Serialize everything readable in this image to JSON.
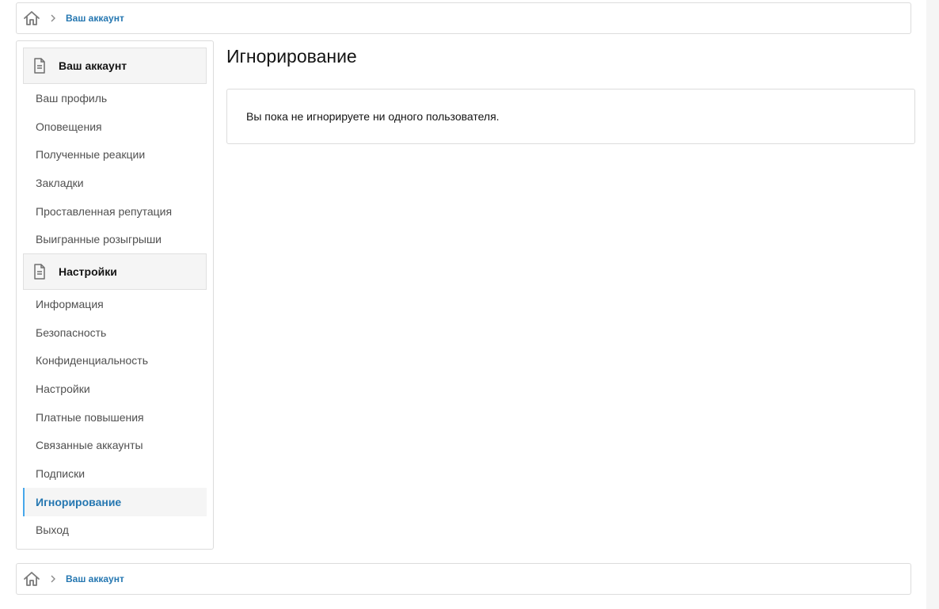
{
  "breadcrumb": {
    "home_icon": "home-icon",
    "separator_icon": "chevron-right-icon",
    "link": "Ваш аккаунт"
  },
  "sidebar": {
    "sections": [
      {
        "title": "Ваш аккаунт",
        "icon": "document-icon",
        "items": [
          {
            "label": "Ваш профиль"
          },
          {
            "label": "Оповещения"
          },
          {
            "label": "Полученные реакции"
          },
          {
            "label": "Закладки"
          },
          {
            "label": "Проставленная репутация"
          },
          {
            "label": "Выигранные розыгрыши"
          }
        ]
      },
      {
        "title": "Настройки",
        "icon": "document-icon",
        "items": [
          {
            "label": "Информация"
          },
          {
            "label": "Безопасность"
          },
          {
            "label": "Конфиденциальность"
          },
          {
            "label": "Настройки"
          },
          {
            "label": "Платные повышения"
          },
          {
            "label": "Связанные аккаунты"
          },
          {
            "label": "Подписки"
          },
          {
            "label": "Игнорирование",
            "active": true
          },
          {
            "label": "Выход"
          }
        ]
      }
    ]
  },
  "main": {
    "title": "Игнорирование",
    "message": "Вы пока не игнорируете ни одного пользователя."
  },
  "colors": {
    "accent": "#2577b1",
    "active_border": "#47a7eb",
    "border": "#dcdcdc",
    "muted_bg": "#f5f5f5"
  }
}
